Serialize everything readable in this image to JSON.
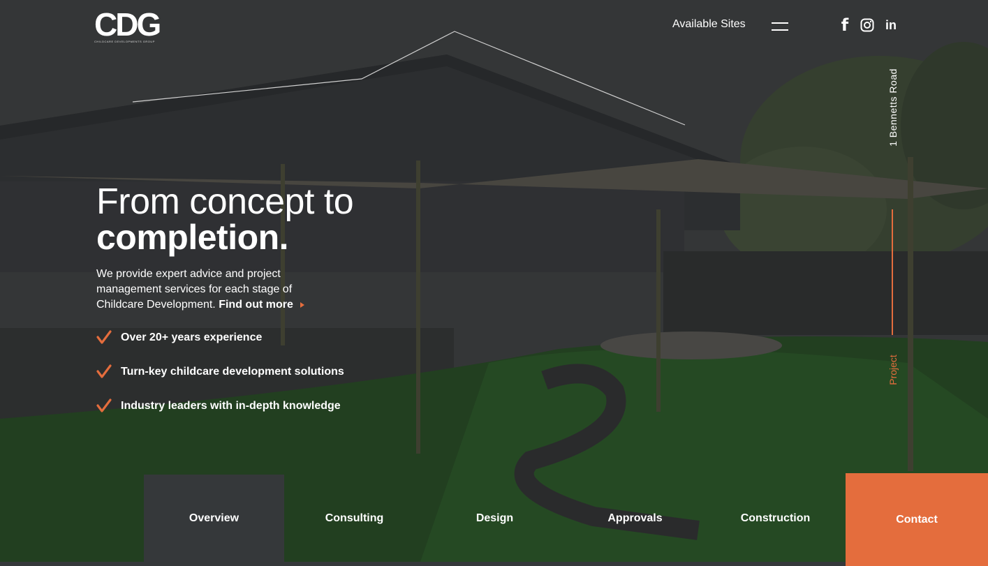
{
  "brand": {
    "logo_text": "CDG",
    "logo_subtitle": "CHILDCARE DEVELOPMENTS GROUP"
  },
  "nav": {
    "available_sites": "Available Sites",
    "menu_icon": "hamburger-icon",
    "social": [
      {
        "name": "facebook-icon",
        "glyph": "f"
      },
      {
        "name": "instagram-icon",
        "glyph": ""
      },
      {
        "name": "linkedin-icon",
        "glyph": "in"
      }
    ]
  },
  "side": {
    "address": "1 Bennetts Road",
    "project_label": "Project"
  },
  "hero": {
    "headline_line1": "From concept to",
    "headline_line2": "completion.",
    "intro_text": "We provide expert advice and project management services for each stage of Childcare Development. ",
    "find_more": "Find out more",
    "bullets": [
      "Over 20+ years experience",
      "Turn-key childcare development solutions",
      "Industry leaders with in-depth knowledge"
    ]
  },
  "tabs": [
    {
      "label": "Overview",
      "active": true
    },
    {
      "label": "Consulting",
      "active": false
    },
    {
      "label": "Design",
      "active": false
    },
    {
      "label": "Approvals",
      "active": false
    },
    {
      "label": "Construction",
      "active": false
    }
  ],
  "contact": {
    "label": "Contact"
  },
  "colors": {
    "accent": "#e46d3d",
    "dark_panel": "#35383a"
  }
}
